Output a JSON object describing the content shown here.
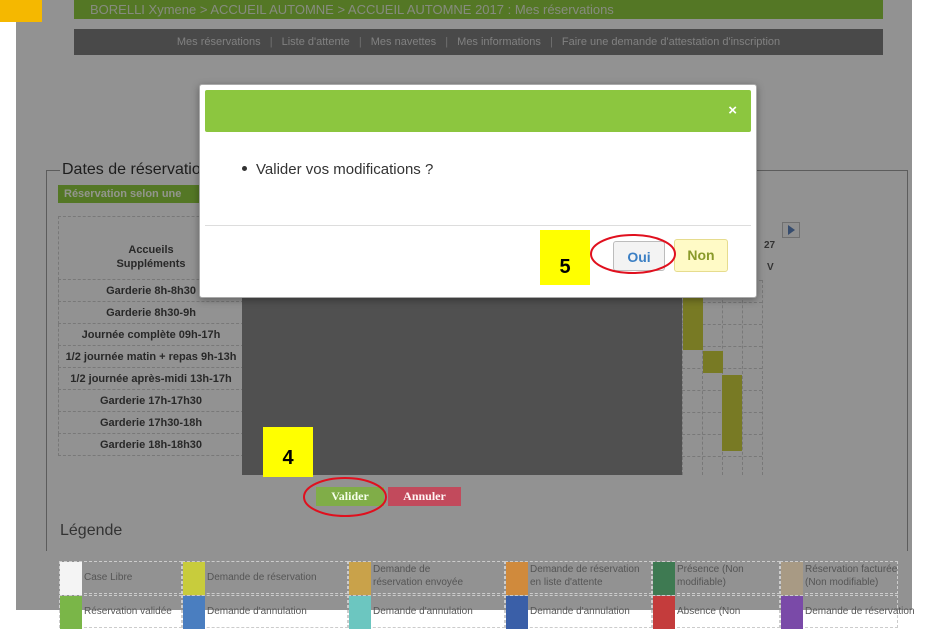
{
  "header": {
    "title_text": "BORELLI Xymene > ACCUEIL AUTOMNE > ACCUEIL AUTOMNE 2017 : Mes réservations"
  },
  "nav": {
    "items": [
      {
        "label": "Mes réservations"
      },
      {
        "label": "Liste d'attente"
      },
      {
        "label": "Mes navettes"
      },
      {
        "label": "Mes informations"
      },
      {
        "label": "Faire une demande d'attestation d'inscription"
      }
    ],
    "separator": "|"
  },
  "section": {
    "title": "Dates de réservatio",
    "tab_label": "Réservation selon une"
  },
  "grid": {
    "header_line1": "Accueils",
    "header_line2": "Suppléments",
    "rows": [
      {
        "label": "Garderie 8h-8h30"
      },
      {
        "label": "Garderie 8h30-9h"
      },
      {
        "label": "Journée complète 09h-17h"
      },
      {
        "label": "1/2 journée matin + repas 9h-13h"
      },
      {
        "label": "1/2 journée après-midi 13h-17h"
      },
      {
        "label": "Garderie 17h-17h30"
      },
      {
        "label": "Garderie 17h30-18h"
      },
      {
        "label": "Garderie 18h-18h30"
      }
    ],
    "date_number": "27",
    "day_letter": "V"
  },
  "modal": {
    "message": "Valider vos modifications ?",
    "close_symbol": "×",
    "oui_label": "Oui",
    "non_label": "Non"
  },
  "annotations": {
    "tag4": "4",
    "tag5": "5"
  },
  "actions": {
    "valider_label": "Valider",
    "annuler_label": "Annuler"
  },
  "legend": {
    "title": "Légende",
    "items": [
      {
        "label_l1": "Case Libre",
        "label_l2": "",
        "color": "#f4f4f4"
      },
      {
        "label_l1": "Demande de réservation",
        "label_l2": "",
        "color": "#c8cc3c"
      },
      {
        "label_l1": "Demande de",
        "label_l2": "réservation envoyée",
        "color": "#c9a24a"
      },
      {
        "label_l1": "Demande de réservation",
        "label_l2": "en liste d'attente",
        "color": "#d08a3c"
      },
      {
        "label_l1": "Présence (Non",
        "label_l2": "modifiable)",
        "color": "#3e7a52"
      },
      {
        "label_l1": "Réservation facturée",
        "label_l2": "(Non modifiable)",
        "color": "#a89a84"
      },
      {
        "label_l1": "Réservation validée",
        "label_l2": "",
        "color": "#7ab648"
      },
      {
        "label_l1": "Demande d'annulation",
        "label_l2": "",
        "color": "#4a7ec0"
      },
      {
        "label_l1": "Demande d'annulation",
        "label_l2": "",
        "color": "#6cc6c0"
      },
      {
        "label_l1": "Demande d'annulation",
        "label_l2": "",
        "color": "#3a5fa8"
      },
      {
        "label_l1": "Absence (Non",
        "label_l2": "",
        "color": "#c43c3c"
      },
      {
        "label_l1": "Demande de réservation",
        "label_l2": "",
        "color": "#7a4aa8"
      }
    ]
  },
  "colors": {
    "brand_green": "#8cc63f",
    "nav_gray": "#7a7a7a",
    "annuler_red": "#c24a5c",
    "highlight_yellow": "#ffff00",
    "annotation_red": "#e0101e"
  }
}
